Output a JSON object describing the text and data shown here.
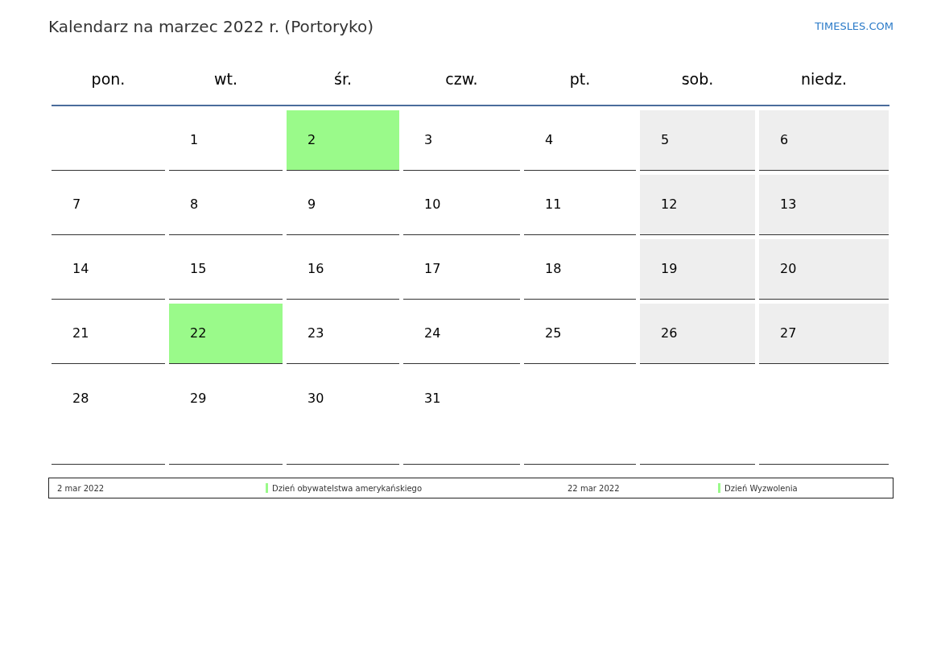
{
  "title": "Kalendarz na marzec 2022 r. (Portoryko)",
  "site_link": "TIMESLES.COM",
  "weekdays": [
    "pon.",
    "wt.",
    "śr.",
    "czw.",
    "pt.",
    "sob.",
    "niedz."
  ],
  "weeks": [
    [
      {
        "kind": "empty",
        "shaded": false,
        "highlighted": false
      },
      {
        "kind": "day",
        "day": "1",
        "shaded": false,
        "highlighted": false
      },
      {
        "kind": "day",
        "day": "2",
        "highlighted": true
      },
      {
        "kind": "day",
        "day": "3",
        "shaded": false,
        "highlighted": false
      },
      {
        "kind": "day",
        "day": "4",
        "shaded": false,
        "highlighted": false
      },
      {
        "kind": "day",
        "day": "5",
        "shaded": true,
        "highlighted": false
      },
      {
        "kind": "day",
        "day": "6",
        "shaded": true,
        "highlighted": false
      }
    ],
    [
      {
        "kind": "day",
        "day": "7",
        "shaded": false,
        "highlighted": false
      },
      {
        "kind": "day",
        "day": "8",
        "shaded": false,
        "highlighted": false
      },
      {
        "kind": "day",
        "day": "9",
        "shaded": false,
        "highlighted": false
      },
      {
        "kind": "day",
        "day": "10",
        "shaded": false,
        "highlighted": false
      },
      {
        "kind": "day",
        "day": "11",
        "shaded": false,
        "highlighted": false
      },
      {
        "kind": "day",
        "day": "12",
        "shaded": true,
        "highlighted": false
      },
      {
        "kind": "day",
        "day": "13",
        "shaded": true,
        "highlighted": false
      }
    ],
    [
      {
        "kind": "day",
        "day": "14",
        "shaded": false,
        "highlighted": false
      },
      {
        "kind": "day",
        "day": "15",
        "shaded": false,
        "highlighted": false
      },
      {
        "kind": "day",
        "day": "16",
        "shaded": false,
        "highlighted": false
      },
      {
        "kind": "day",
        "day": "17",
        "shaded": false,
        "highlighted": false
      },
      {
        "kind": "day",
        "day": "18",
        "shaded": false,
        "highlighted": false
      },
      {
        "kind": "day",
        "day": "19",
        "shaded": true,
        "highlighted": false
      },
      {
        "kind": "day",
        "day": "20",
        "shaded": true,
        "highlighted": false
      }
    ],
    [
      {
        "kind": "day",
        "day": "21",
        "shaded": false,
        "highlighted": false
      },
      {
        "kind": "day",
        "day": "22",
        "highlighted": true
      },
      {
        "kind": "day",
        "day": "23",
        "shaded": false,
        "highlighted": false
      },
      {
        "kind": "day",
        "day": "24",
        "shaded": false,
        "highlighted": false
      },
      {
        "kind": "day",
        "day": "25",
        "shaded": false,
        "highlighted": false
      },
      {
        "kind": "day",
        "day": "26",
        "shaded": true,
        "highlighted": false
      },
      {
        "kind": "day",
        "day": "27",
        "shaded": true,
        "highlighted": false
      }
    ],
    [
      {
        "kind": "day",
        "day": "28",
        "shaded": false,
        "highlighted": false
      },
      {
        "kind": "day",
        "day": "29",
        "shaded": false,
        "highlighted": false
      },
      {
        "kind": "day",
        "day": "30",
        "shaded": false,
        "highlighted": false
      },
      {
        "kind": "day",
        "day": "31",
        "shaded": false,
        "highlighted": false
      },
      {
        "kind": "empty",
        "shaded": false,
        "highlighted": false
      },
      {
        "kind": "empty",
        "shaded": false,
        "highlighted": false
      },
      {
        "kind": "empty",
        "shaded": false,
        "highlighted": false
      }
    ]
  ],
  "holidays": [
    {
      "date": "2 mar 2022",
      "name": "Dzień obywatelstwa amerykańskiego",
      "color": "#9afa8a"
    },
    {
      "date": "22 mar 2022",
      "name": "Dzień Wyzwolenia",
      "color": "#9afa8a"
    }
  ]
}
